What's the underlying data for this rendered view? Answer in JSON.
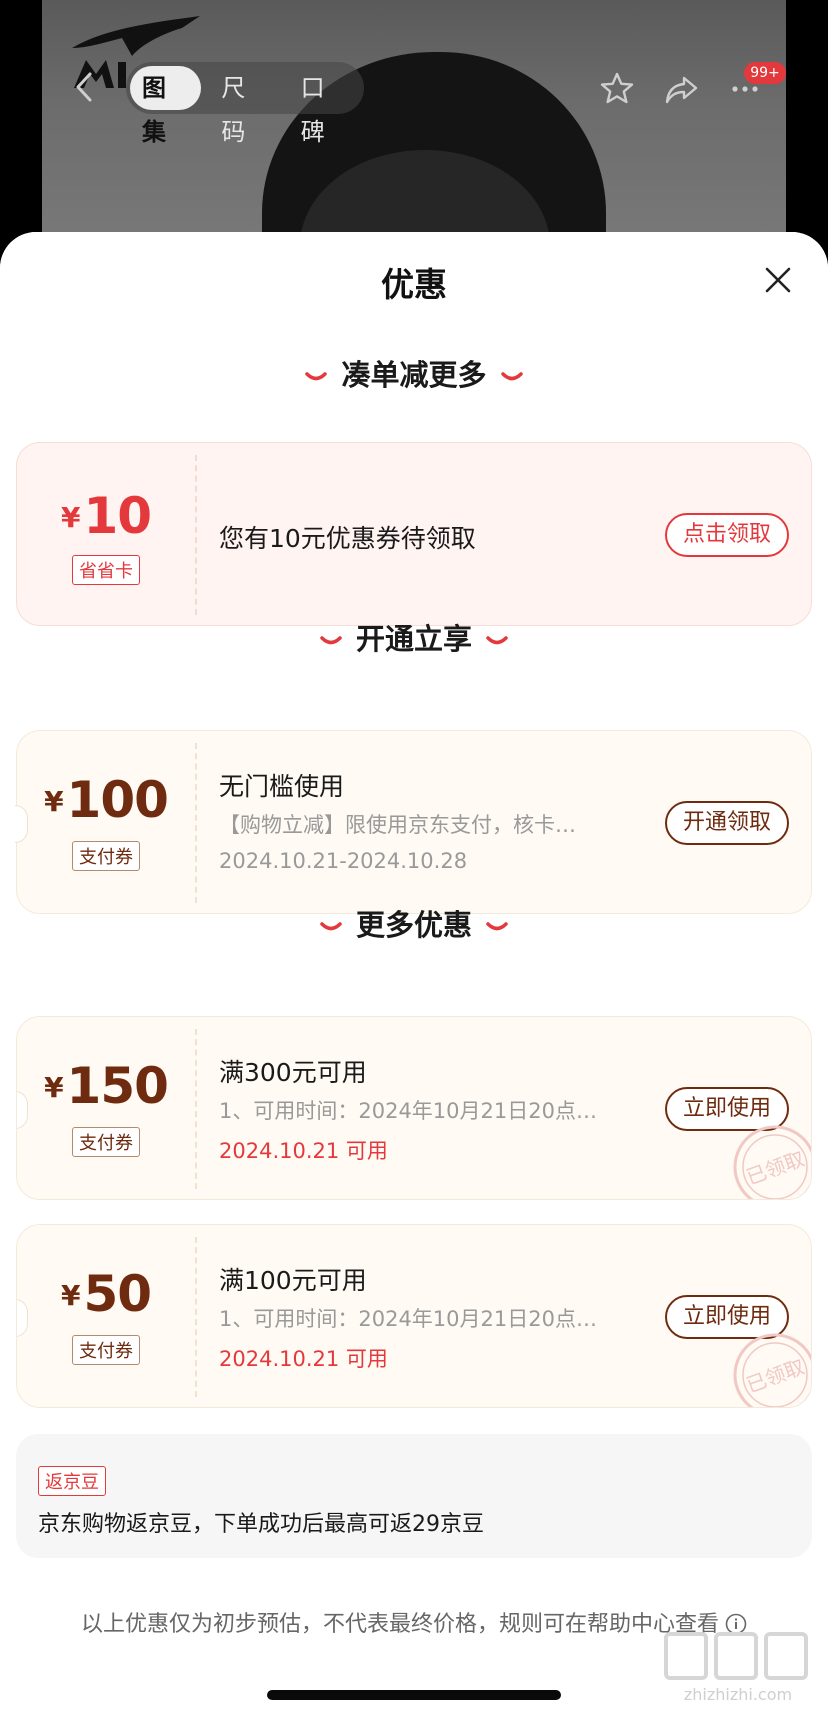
{
  "header": {
    "tabs": [
      {
        "label": "图集",
        "active": true
      },
      {
        "label": "尺码",
        "active": false
      },
      {
        "label": "口碑",
        "active": false
      }
    ],
    "badge": "99+",
    "icons": [
      "back-icon",
      "star-icon",
      "share-icon",
      "more-icon"
    ]
  },
  "sheet": {
    "title": "优惠",
    "close_icon": "close-icon",
    "sections": [
      {
        "heading": "凑单减更多",
        "coupons": [
          {
            "currency": "¥",
            "amount": "10",
            "tag": "省省卡",
            "title": "您有10元优惠券待领取",
            "button": "点击领取",
            "style": "red"
          }
        ]
      },
      {
        "heading": "开通立享",
        "coupons": [
          {
            "currency": "¥",
            "amount": "100",
            "tag": "支付券",
            "title": "无门槛使用",
            "desc": "【购物立减】限使用京东支付，核卡…",
            "date": "2024.10.21-2024.10.28",
            "button": "开通领取",
            "style": "beige"
          }
        ]
      },
      {
        "heading": "更多优惠",
        "coupons": [
          {
            "currency": "¥",
            "amount": "150",
            "tag": "支付券",
            "title": "满300元可用",
            "desc": "1、可用时间：2024年10月21日20点…",
            "date": "2024.10.21 可用",
            "button": "立即使用",
            "stamp": "已领取",
            "style": "beige"
          },
          {
            "currency": "¥",
            "amount": "50",
            "tag": "支付券",
            "title": "满100元可用",
            "desc": "1、可用时间：2024年10月21日20点…",
            "date": "2024.10.21 可用",
            "button": "立即使用",
            "stamp": "已领取",
            "style": "beige"
          }
        ]
      }
    ],
    "beans": {
      "tag": "返京豆",
      "text": "京东购物返京豆，下单成功后最高可返29京豆"
    },
    "footnote": "以上优惠仅为初步预估，不代表最终价格，规则可在帮助中心查看",
    "watermark": "值 什么值得买 zhizhizhi.com"
  },
  "colors": {
    "accent_red": "#e4393c",
    "brown": "#6e2b0f",
    "red_card_bg": "#fff4f1",
    "beige_card_bg": "#fffaf3"
  }
}
